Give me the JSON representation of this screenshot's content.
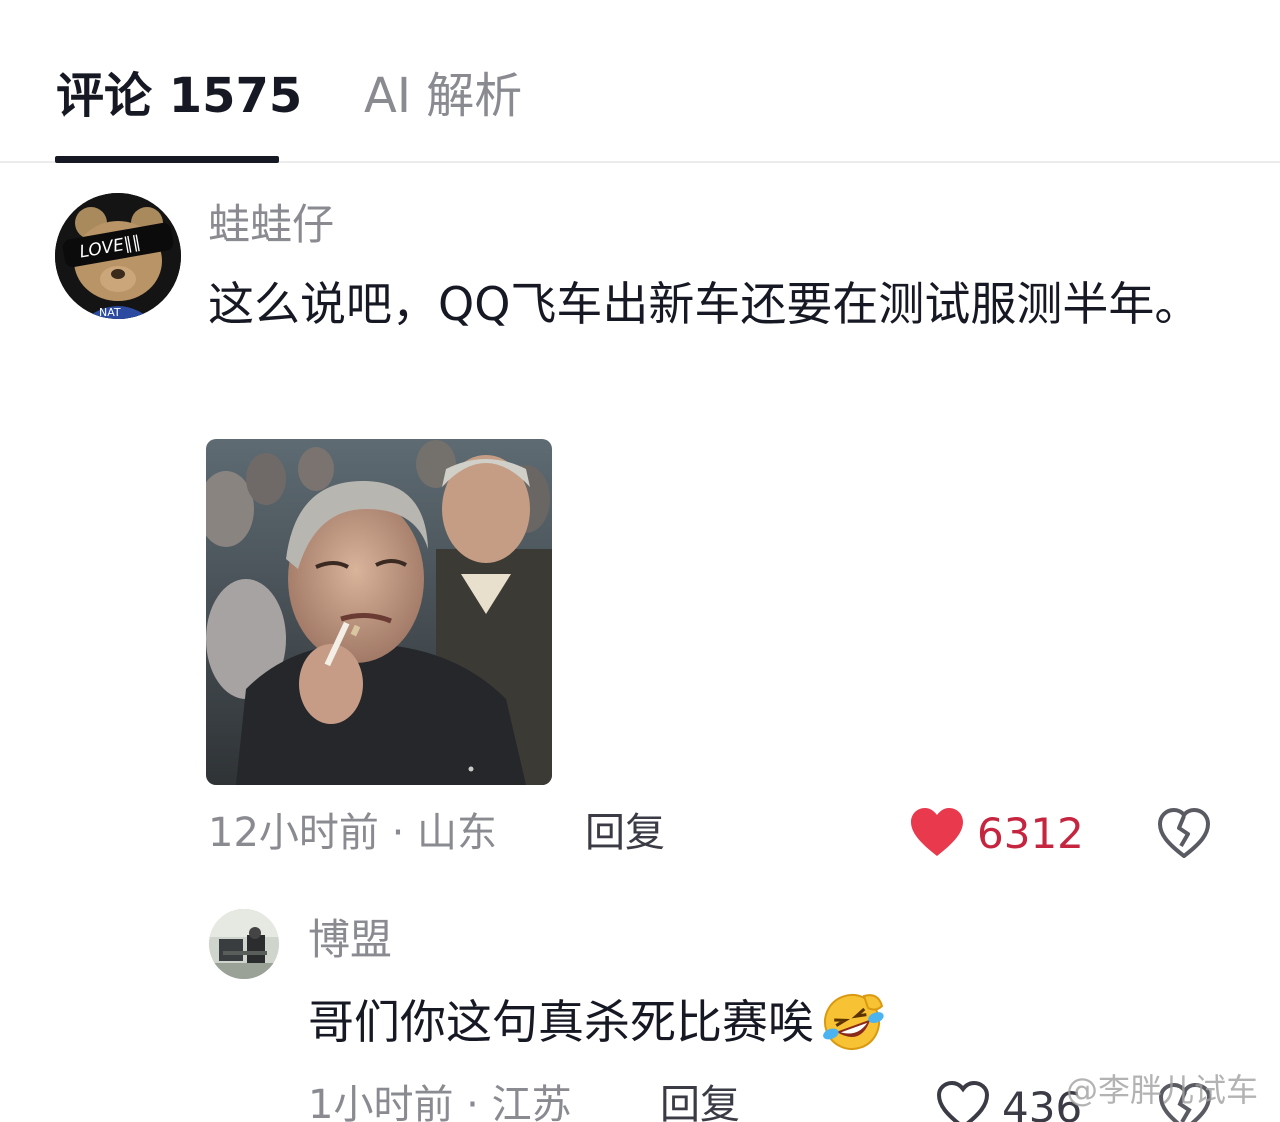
{
  "tabs": {
    "comments_label": "评论 1575",
    "ai_label": "AI 解析"
  },
  "comment": {
    "username": "蛙蛙仔",
    "text": "这么说吧，QQ飞车出新车还要在测试服测半年。",
    "time_location": "12小时前 · 山东",
    "reply_label": "回复",
    "like_count": "6312",
    "liked": true,
    "accent_color": "#e8394d",
    "meme_image": "elderly-man-smoking-meme",
    "avatar": "bear-with-love-sunglasses"
  },
  "reply": {
    "username": "博盟",
    "text": "哥们你这句真杀死比赛唉",
    "emoji": "rolling-laughing-emoji",
    "time_location": "1小时前 · 江苏",
    "reply_label": "回复",
    "like_count": "436",
    "liked": false
  },
  "watermark": {
    "text": "@李胖儿试车"
  }
}
